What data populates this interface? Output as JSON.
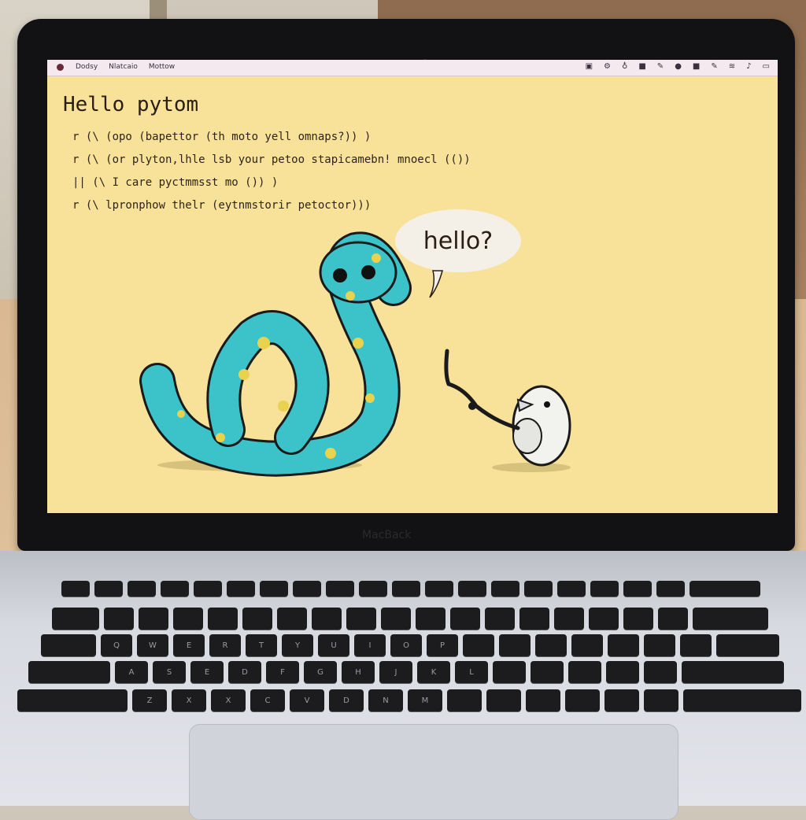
{
  "menubar": {
    "menu_items": [
      "Dodsy",
      "Nlatcaio",
      "Mottow"
    ],
    "status_icons": [
      "document-icon",
      "gear-icon",
      "shield-icon",
      "square-icon",
      "pen-icon",
      "circle-icon",
      "square-icon",
      "pen-icon",
      "wifi-icon",
      "sound-icon",
      "battery-icon"
    ]
  },
  "code": {
    "title": "Hello pytom",
    "lines": [
      "r (\\ (opo (bapettor (th moto yell omnaps?)) )",
      "r (\\ (or plyton,lhle lsb your petoo stapicamebn! mnoecl (())",
      "|| (\\ I care pyctmmsst mo ()) )",
      "r (\\ lpronphow thelr (eytnmstorir petoctor)))"
    ]
  },
  "speech_bubble": {
    "text": "hello?"
  },
  "laptop": {
    "brand": "MacBack"
  },
  "keyboard": {
    "rows": [
      [
        "",
        "",
        "",
        "",
        "",
        "",
        "",
        "",
        "",
        "",
        "",
        "",
        "",
        ""
      ],
      [
        "",
        "Q",
        "W",
        "E",
        "R",
        "T",
        "Y",
        "U",
        "I",
        "O",
        "P",
        "",
        ""
      ],
      [
        "",
        "A",
        "S",
        "E",
        "D",
        "F",
        "G",
        "H",
        "J",
        "K",
        "L",
        "",
        ""
      ],
      [
        "",
        "Z",
        "X",
        "X",
        "C",
        "V",
        "D",
        "N",
        "M",
        "",
        "",
        ""
      ],
      [
        "",
        "",
        "",
        "",
        "",
        "",
        ""
      ]
    ]
  },
  "colors": {
    "screen_bg": "#f8e199",
    "snake_body": "#3cc3c9",
    "snake_spots": "#e8d24e",
    "bezel": "#121214"
  }
}
